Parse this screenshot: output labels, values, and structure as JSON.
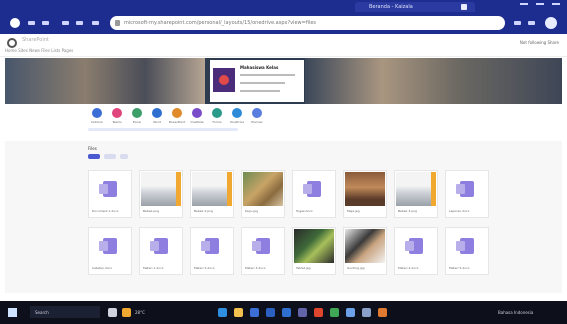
{
  "browser": {
    "tab_title": "Beranda - Kaizala",
    "address": "microsoft-my.sharepoint.com/personal/_layouts/15/onedrive.aspx?view=files"
  },
  "app": {
    "title": "SharePoint",
    "nav_links": "Home  Sites  News  Files  Lists  Pages",
    "right_text": "Not following  Share"
  },
  "banner_card": {
    "title": "Mahasiswa Kelas",
    "line1": "Communication site",
    "line2": "Owner: Admin"
  },
  "apps": [
    {
      "label": "Outlook",
      "color": "#3b6fd6"
    },
    {
      "label": "Teams",
      "color": "#e0457b"
    },
    {
      "label": "Excel",
      "color": "#3c9f6a"
    },
    {
      "label": "Word",
      "color": "#2f6fd0"
    },
    {
      "label": "PowerPoint",
      "color": "#e08a2a"
    },
    {
      "label": "OneNote",
      "color": "#7b4cc9"
    },
    {
      "label": "Forms",
      "color": "#2a9a8a"
    },
    {
      "label": "OneDrive",
      "color": "#2e8bd8"
    },
    {
      "label": "Planner",
      "color": "#5a7de0"
    }
  ],
  "files": {
    "section_title": "Files",
    "filter_1": "Recent",
    "filter_2": "Shared"
  },
  "tiles": [
    {
      "name": "Document 1.docx",
      "kind": "doc"
    },
    {
      "name": "Bebek.png",
      "kind": "photo1"
    },
    {
      "name": "Bebek 2.png",
      "kind": "photo1"
    },
    {
      "name": "Kayu.jpg",
      "kind": "photo2"
    },
    {
      "name": "Tugas.docx",
      "kind": "doc"
    },
    {
      "name": "Meja.jpg",
      "kind": "photo3"
    },
    {
      "name": "Bebek 3.png",
      "kind": "photo1"
    },
    {
      "name": "Laporan.docx",
      "kind": "doc"
    },
    {
      "name": "Catatan.docx",
      "kind": "doc"
    },
    {
      "name": "Materi 1.docx",
      "kind": "doc"
    },
    {
      "name": "Materi 2.docx",
      "kind": "doc"
    },
    {
      "name": "Materi 3.docx",
      "kind": "doc"
    },
    {
      "name": "Tablet.jpg",
      "kind": "photo4"
    },
    {
      "name": "Gunting.jpg",
      "kind": "photo5"
    },
    {
      "name": "Materi 4.docx",
      "kind": "doc"
    },
    {
      "name": "Materi 5.docx",
      "kind": "doc"
    }
  ],
  "taskbar": {
    "search": "Search",
    "weather": "28°C",
    "status": "Bahasa Indonesia"
  }
}
